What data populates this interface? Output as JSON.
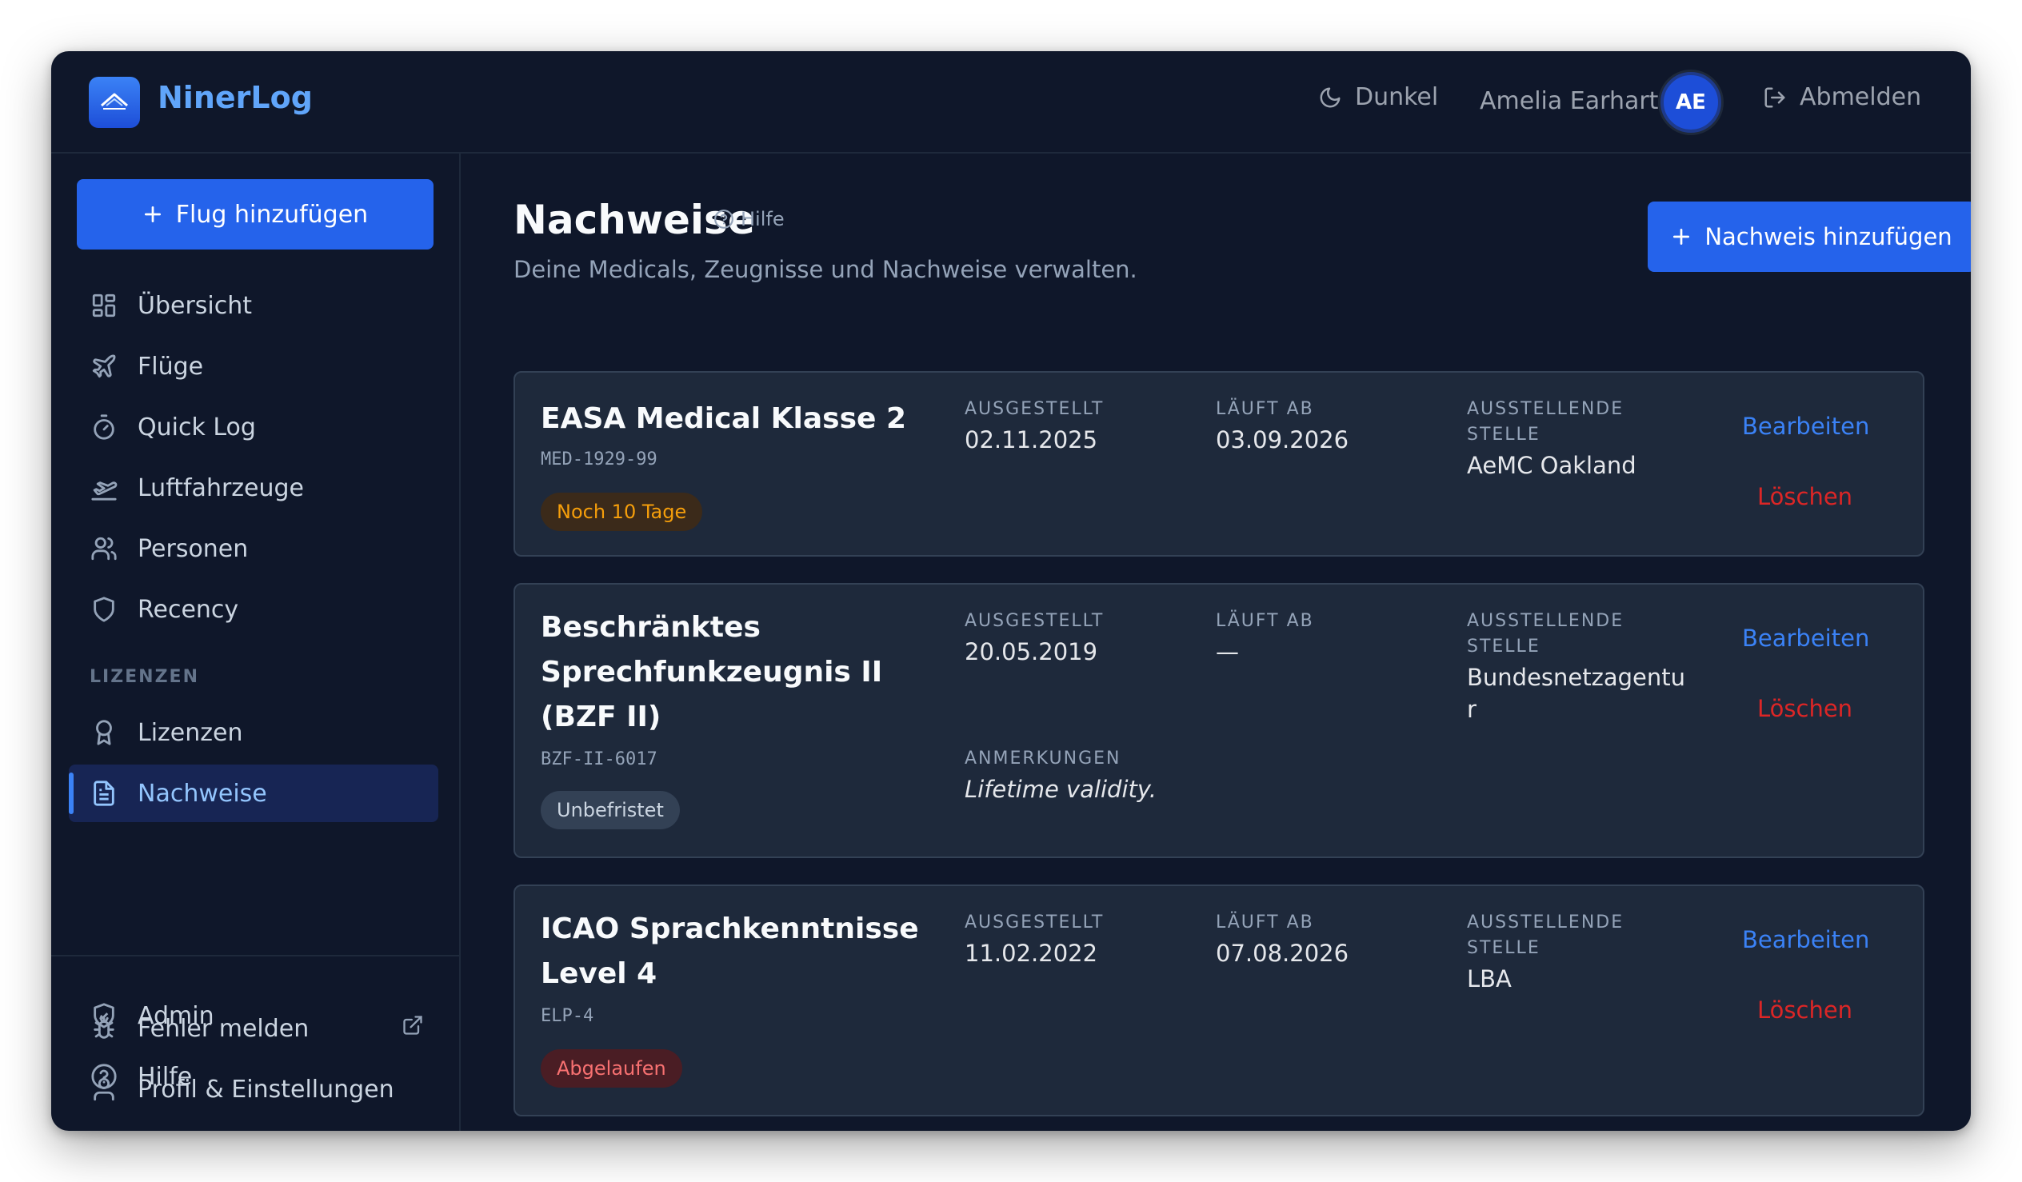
{
  "app": {
    "brand": "NinerLog"
  },
  "header": {
    "theme_label": "Dunkel",
    "user_name": "Amelia Earhart",
    "user_initials": "AE",
    "logout_label": "Abmelden"
  },
  "sidebar": {
    "add_flight_label": "Flug hinzufügen",
    "items": [
      {
        "label": "Übersicht",
        "icon": "grid-icon"
      },
      {
        "label": "Flüge",
        "icon": "plane-icon"
      },
      {
        "label": "Quick Log",
        "icon": "stopwatch-icon"
      },
      {
        "label": "Luftfahrzeuge",
        "icon": "plane-takeoff-icon"
      },
      {
        "label": "Personen",
        "icon": "users-icon"
      },
      {
        "label": "Recency",
        "icon": "shield-icon"
      }
    ],
    "section_label": "LIZENZEN",
    "license_items": [
      {
        "label": "Lizenzen",
        "icon": "award-icon"
      },
      {
        "label": "Nachweise",
        "icon": "document-icon",
        "active": true
      }
    ],
    "bottom_items": [
      {
        "label": "Admin",
        "icon": "shield-check-icon"
      },
      {
        "label": "Hilfe",
        "icon": "help-circle-icon"
      },
      {
        "label": "Fehler melden",
        "icon": "bug-icon"
      },
      {
        "label": "Profil & Einstellungen",
        "icon": "user-icon"
      }
    ]
  },
  "main": {
    "title": "Nachweise",
    "help_label": "Hilfe",
    "subtitle": "Deine Medicals, Zeugnisse und Nachweise verwalten.",
    "add_label": "Nachweis hinzufügen",
    "field_labels": {
      "issued": "AUSGESTELLT",
      "expires": "LÄUFT AB",
      "authority": "AUSSTELLENDE STELLE",
      "notes": "ANMERKUNGEN"
    },
    "edit_label": "Bearbeiten",
    "delete_label": "Löschen",
    "cards": [
      {
        "title": "EASA Medical Klasse 2",
        "code": "MED-1929-99",
        "badge": "Noch 10 Tage",
        "badge_kind": "warning",
        "issued": "02.11.2025",
        "expires": "03.09.2026",
        "authority": "AeMC Oakland"
      },
      {
        "title": "Beschränktes Sprechfunkzeugnis II (BZF II)",
        "code": "BZF-II-6017",
        "badge": "Unbefristet",
        "badge_kind": "neutral",
        "issued": "20.05.2019",
        "expires": "—",
        "authority": "Bundesnetzagentur",
        "notes": "Lifetime validity."
      },
      {
        "title": "ICAO Sprachkenntnisse Level 4",
        "code": "ELP-4",
        "badge": "Abgelaufen",
        "badge_kind": "danger",
        "issued": "11.02.2022",
        "expires": "07.08.2026",
        "authority": "LBA"
      }
    ]
  },
  "colors": {
    "background": "#0f172a",
    "card": "#1e293b",
    "accent": "#2563eb",
    "link": "#3b82f6",
    "danger": "#dc2626",
    "warning": "#f59e0b"
  }
}
